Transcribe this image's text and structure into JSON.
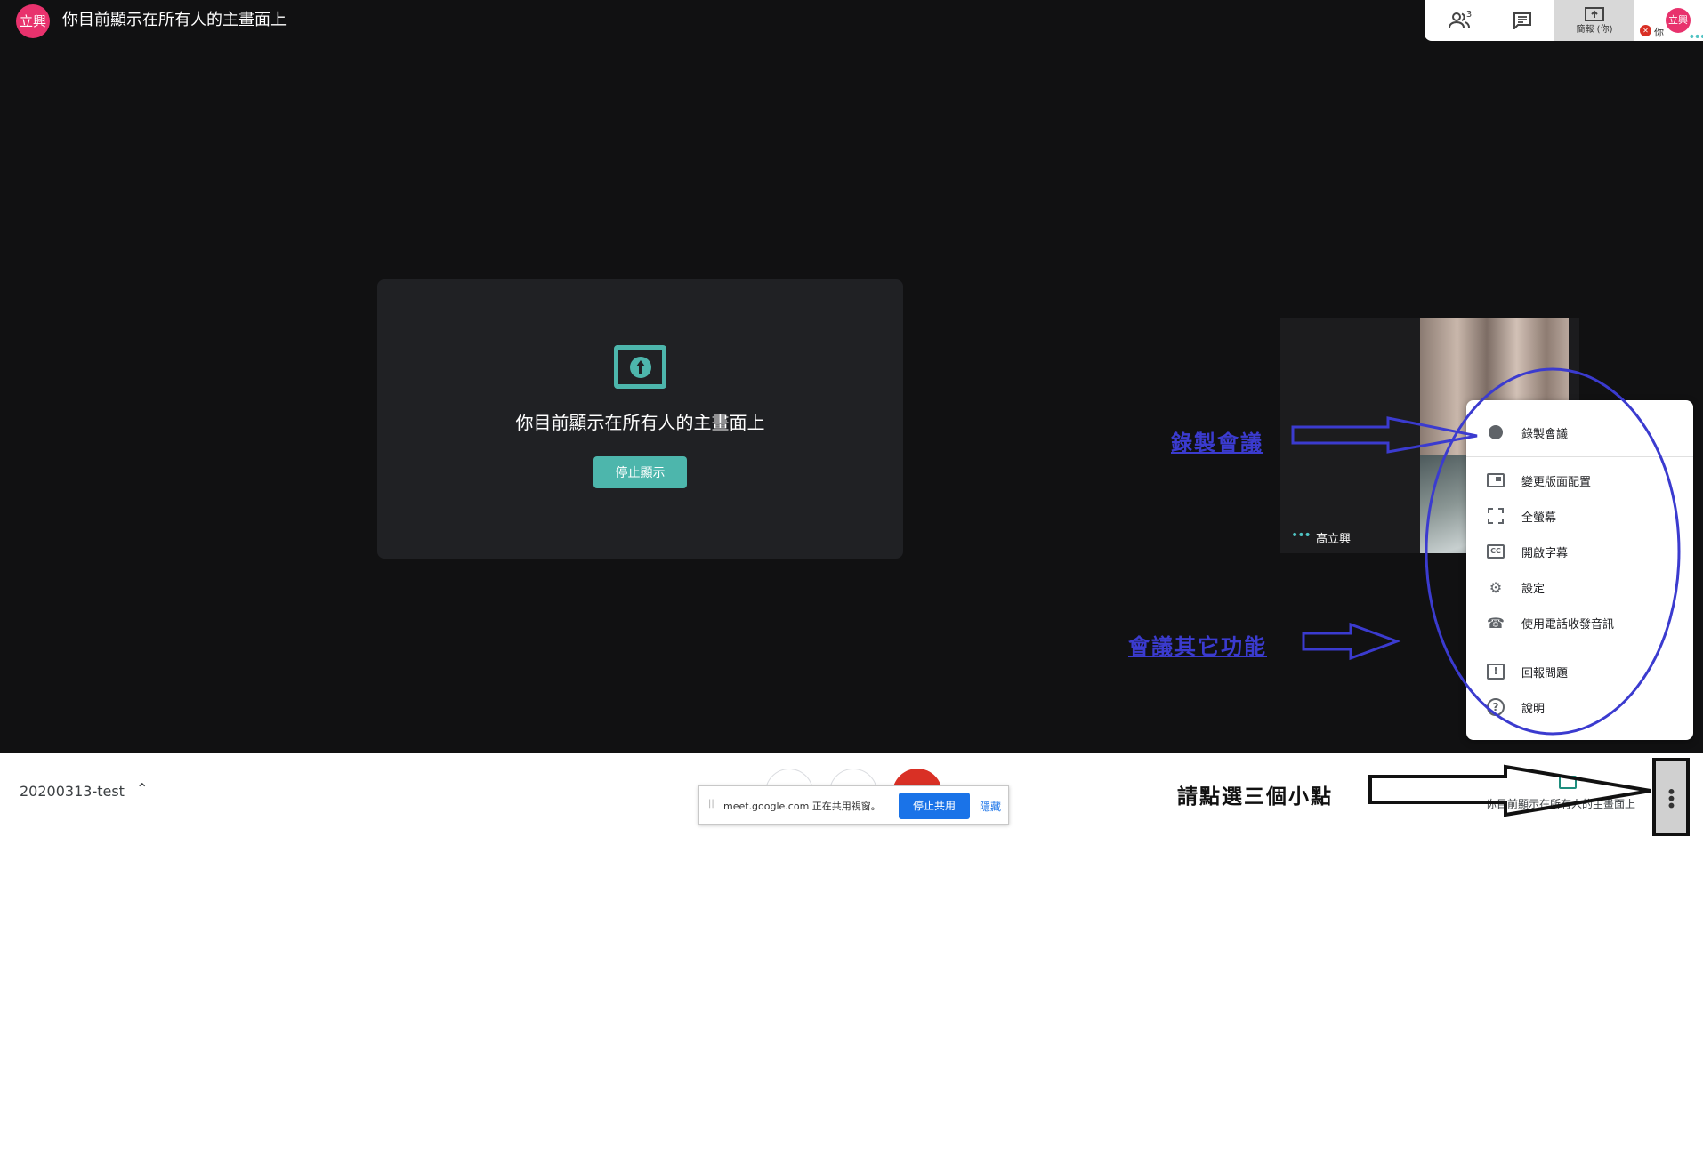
{
  "header": {
    "avatar_initials": "立興",
    "title": "你目前顯示在所有人的主畫面上"
  },
  "top_bar": {
    "people_count": "3",
    "present_label": "簡報 (你)",
    "self_label": "你",
    "self_avatar": "立興"
  },
  "present_card": {
    "icon": "present-to-all-icon",
    "text": "你目前顯示在所有人的主畫面上",
    "stop_button": "停止顯示"
  },
  "participant": {
    "name": "高立興"
  },
  "menu": {
    "items": [
      {
        "icon": "record-icon",
        "label": "錄製會議"
      },
      {
        "icon": "layout-icon",
        "label": "變更版面配置"
      },
      {
        "icon": "fullscreen-icon",
        "label": "全螢幕"
      },
      {
        "icon": "captions-icon",
        "label": "開啟字幕"
      },
      {
        "icon": "settings-icon",
        "label": "設定"
      },
      {
        "icon": "phone-audio-icon",
        "label": "使用電話收發音訊"
      },
      {
        "icon": "feedback-icon",
        "label": "回報問題"
      },
      {
        "icon": "help-icon",
        "label": "說明"
      }
    ]
  },
  "bottom_bar": {
    "meeting_name": "20200313-test",
    "presenting_text": "你目前顯示在所有人的主畫面上"
  },
  "share_bar": {
    "text": "meet.google.com 正在共用視窗。",
    "stop_button": "停止共用",
    "hide_link": "隱藏"
  },
  "annotations": {
    "record": "錄製會議",
    "other": "會議其它功能",
    "click_dots": "請點選三個小點"
  },
  "colors": {
    "accent_teal": "#4db6ac",
    "avatar_pink": "#e8326d",
    "hangup_red": "#d93025",
    "share_blue": "#1a73e8",
    "annotation_blue": "#3b3bcf"
  }
}
